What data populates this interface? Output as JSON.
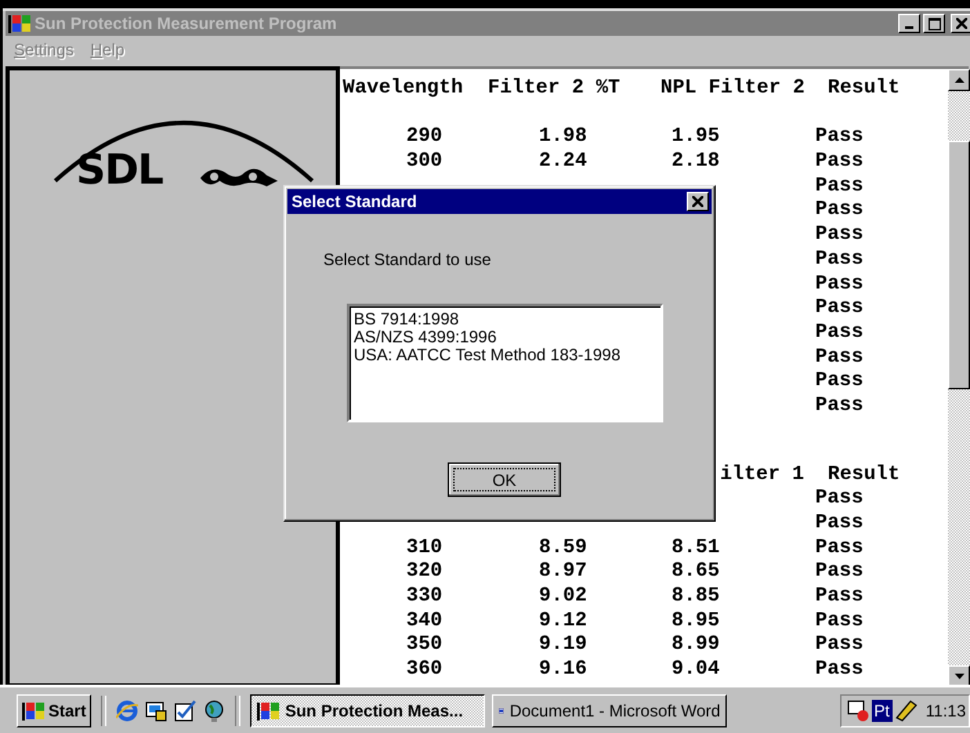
{
  "window": {
    "title": "Sun Protection Measurement Program",
    "active": false
  },
  "menu": [
    {
      "label": "Settings",
      "disabled": true
    },
    {
      "label": "Help",
      "disabled": true
    }
  ],
  "logo": {
    "text": "SDL"
  },
  "result_blocks": [
    {
      "header": {
        "wavelength": "Wavelength",
        "filter": "Filter 2 %T",
        "npl": "NPL Filter 2",
        "result": "Result"
      },
      "rows": [
        {
          "cells": [
            "290",
            "1.98",
            "1.95",
            "Pass"
          ]
        },
        {
          "cells": [
            "300",
            "2.24",
            "2.18",
            "Pass"
          ]
        },
        {
          "cells": [
            "",
            "",
            "",
            "Pass"
          ]
        },
        {
          "cells": [
            "",
            "",
            "",
            "Pass"
          ]
        },
        {
          "cells": [
            "",
            "",
            "",
            "Pass"
          ]
        },
        {
          "cells": [
            "",
            "",
            "",
            "Pass"
          ]
        },
        {
          "cells": [
            "",
            "",
            "",
            "Pass"
          ]
        },
        {
          "cells": [
            "",
            "",
            "",
            "Pass"
          ]
        },
        {
          "cells": [
            "",
            "",
            "",
            "Pass"
          ]
        },
        {
          "cells": [
            "",
            "",
            "",
            "Pass"
          ]
        },
        {
          "cells": [
            "",
            "",
            "",
            "Pass"
          ]
        },
        {
          "cells": [
            "",
            "",
            "",
            "Pass"
          ]
        }
      ]
    },
    {
      "header": {
        "npl": "ilter 1",
        "result": "Result"
      },
      "rows": [
        {
          "cells": [
            "",
            "",
            "",
            "Pass"
          ]
        },
        {
          "cells": [
            "",
            "",
            "",
            "Pass"
          ]
        },
        {
          "cells": [
            "310",
            "8.59",
            "8.51",
            "Pass"
          ]
        },
        {
          "cells": [
            "320",
            "8.97",
            "8.65",
            "Pass"
          ]
        },
        {
          "cells": [
            "330",
            "9.02",
            "8.85",
            "Pass"
          ]
        },
        {
          "cells": [
            "340",
            "9.12",
            "8.95",
            "Pass"
          ]
        },
        {
          "cells": [
            "350",
            "9.19",
            "8.99",
            "Pass"
          ]
        },
        {
          "cells": [
            "360",
            "9.16",
            "9.04",
            "Pass"
          ]
        }
      ]
    }
  ],
  "dialog": {
    "title": "Select Standard",
    "prompt": "Select Standard to use",
    "options": [
      {
        "label": "BS 7914:1998",
        "selected": false
      },
      {
        "label": "AS/NZS 4399:1996",
        "selected": false
      },
      {
        "label": "USA: AATCC Test Method 183-1998",
        "selected": false
      }
    ],
    "button": "OK"
  },
  "taskbar": {
    "start": "Start",
    "tasks": [
      {
        "label": "Sun Protection Meas...",
        "selected": true
      },
      {
        "label": "Document1 - Microsoft Word",
        "selected": false
      }
    ],
    "pt_label": "Pt",
    "clock": "11:13"
  }
}
